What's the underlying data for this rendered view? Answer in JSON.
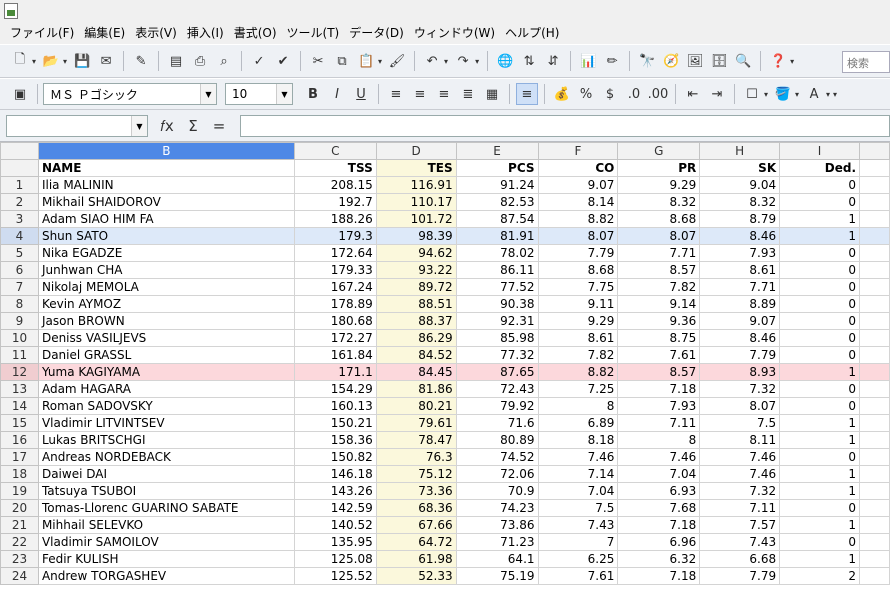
{
  "menu": [
    "ファイル(F)",
    "編集(E)",
    "表示(V)",
    "挿入(I)",
    "書式(O)",
    "ツール(T)",
    "データ(D)",
    "ウィンドウ(W)",
    "ヘルプ(H)"
  ],
  "toolbar": {
    "search_placeholder": "検索"
  },
  "format_bar": {
    "font_name": "ＭＳ Ｐゴシック",
    "font_size": "10"
  },
  "formula_bar": {
    "name_box": "",
    "formula": ""
  },
  "sheet": {
    "selected_column": "B",
    "column_letters": [
      "B",
      "C",
      "D",
      "E",
      "F",
      "G",
      "H",
      "I"
    ],
    "headers": [
      "NAME",
      "TSS",
      "TES",
      "PCS",
      "CO",
      "PR",
      "SK",
      "Ded."
    ],
    "rows": [
      [
        "1",
        "Ilia MALININ",
        "208.15",
        "116.91",
        "91.24",
        "9.07",
        "9.29",
        "9.04",
        "0"
      ],
      [
        "2",
        "Mikhail SHAIDOROV",
        "192.7",
        "110.17",
        "82.53",
        "8.14",
        "8.32",
        "8.32",
        "0"
      ],
      [
        "3",
        "Adam SIAO HIM FA",
        "188.26",
        "101.72",
        "87.54",
        "8.82",
        "8.68",
        "8.79",
        "1"
      ],
      [
        "4",
        "Shun SATO",
        "179.3",
        "98.39",
        "81.91",
        "8.07",
        "8.07",
        "8.46",
        "1"
      ],
      [
        "5",
        "Nika EGADZE",
        "172.64",
        "94.62",
        "78.02",
        "7.79",
        "7.71",
        "7.93",
        "0"
      ],
      [
        "6",
        "Junhwan CHA",
        "179.33",
        "93.22",
        "86.11",
        "8.68",
        "8.57",
        "8.61",
        "0"
      ],
      [
        "7",
        "Nikolaj MEMOLA",
        "167.24",
        "89.72",
        "77.52",
        "7.75",
        "7.82",
        "7.71",
        "0"
      ],
      [
        "8",
        "Kevin AYMOZ",
        "178.89",
        "88.51",
        "90.38",
        "9.11",
        "9.14",
        "8.89",
        "0"
      ],
      [
        "9",
        "Jason BROWN",
        "180.68",
        "88.37",
        "92.31",
        "9.29",
        "9.36",
        "9.07",
        "0"
      ],
      [
        "10",
        "Deniss VASILJEVS",
        "172.27",
        "86.29",
        "85.98",
        "8.61",
        "8.75",
        "8.46",
        "0"
      ],
      [
        "11",
        "Daniel GRASSL",
        "161.84",
        "84.52",
        "77.32",
        "7.82",
        "7.61",
        "7.79",
        "0"
      ],
      [
        "12",
        "Yuma KAGIYAMA",
        "171.1",
        "84.45",
        "87.65",
        "8.82",
        "8.57",
        "8.93",
        "1"
      ],
      [
        "13",
        "Adam HAGARA",
        "154.29",
        "81.86",
        "72.43",
        "7.25",
        "7.18",
        "7.32",
        "0"
      ],
      [
        "14",
        "Roman SADOVSKY",
        "160.13",
        "80.21",
        "79.92",
        "8",
        "7.93",
        "8.07",
        "0"
      ],
      [
        "15",
        "Vladimir LITVINTSEV",
        "150.21",
        "79.61",
        "71.6",
        "6.89",
        "7.11",
        "7.5",
        "1"
      ],
      [
        "16",
        "Lukas BRITSCHGI",
        "158.36",
        "78.47",
        "80.89",
        "8.18",
        "8",
        "8.11",
        "1"
      ],
      [
        "17",
        "Andreas NORDEBACK",
        "150.82",
        "76.3",
        "74.52",
        "7.46",
        "7.46",
        "7.46",
        "0"
      ],
      [
        "18",
        "Daiwei DAI",
        "146.18",
        "75.12",
        "72.06",
        "7.14",
        "7.04",
        "7.46",
        "1"
      ],
      [
        "19",
        "Tatsuya TSUBOI",
        "143.26",
        "73.36",
        "70.9",
        "7.04",
        "6.93",
        "7.32",
        "1"
      ],
      [
        "20",
        "Tomas-Llorenc GUARINO SABATE",
        "142.59",
        "68.36",
        "74.23",
        "7.5",
        "7.68",
        "7.11",
        "0"
      ],
      [
        "21",
        "Mihhail SELEVKO",
        "140.52",
        "67.66",
        "73.86",
        "7.43",
        "7.18",
        "7.57",
        "1"
      ],
      [
        "22",
        "Vladimir SAMOILOV",
        "135.95",
        "64.72",
        "71.23",
        "7",
        "6.96",
        "7.43",
        "0"
      ],
      [
        "23",
        "Fedir KULISH",
        "125.08",
        "61.98",
        "64.1",
        "6.25",
        "6.32",
        "6.68",
        "1"
      ],
      [
        "24",
        "Andrew TORGASHEV",
        "125.52",
        "52.33",
        "75.19",
        "7.61",
        "7.18",
        "7.79",
        "2"
      ]
    ],
    "highlighted_rows": {
      "4": "blue",
      "12": "pink"
    },
    "colors": {
      "selection_blue": "#4e88e6",
      "row_blue": "#dde9f9",
      "row_pink": "#fcd8dc",
      "tes_column": "#fbf8dc"
    }
  }
}
